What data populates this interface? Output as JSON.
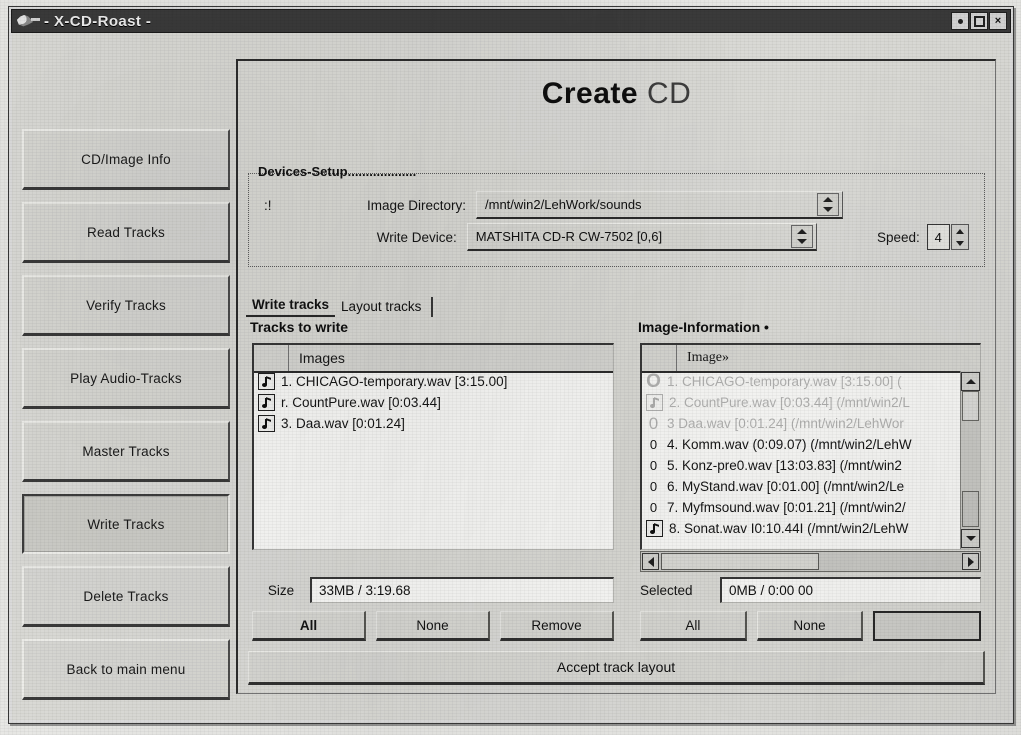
{
  "window": {
    "title": "- X-CD-Roast -",
    "icon": "app-icon",
    "buttons": [
      {
        "name": "minimize-button",
        "glyph": "dot"
      },
      {
        "name": "maximize-button",
        "glyph": "square"
      },
      {
        "name": "close-button",
        "glyph": "×"
      }
    ]
  },
  "page": {
    "title_strong": "Create",
    "title_light": "CD"
  },
  "sidebar": {
    "items": [
      {
        "label": "CD/Image Info",
        "active": false
      },
      {
        "label": "Read Tracks",
        "active": false
      },
      {
        "label": "Verify Tracks",
        "active": false
      },
      {
        "label": "Play Audio-Tracks",
        "active": false
      },
      {
        "label": "Master Tracks",
        "active": false
      },
      {
        "label": "Write Tracks",
        "active": true
      },
      {
        "label": "Delete Tracks",
        "active": false
      },
      {
        "label": "Back to main menu",
        "active": false
      }
    ]
  },
  "devices": {
    "group_label": "Devices-Setup",
    "dots": "...................",
    "marker": ":!",
    "image_dir_label": "Image Directory:",
    "image_dir_value": "/mnt/win2/LehWork/sounds",
    "write_device_label": "Write Device:",
    "write_device_value": "MATSHITA CD-R   CW-7502   [0,6]",
    "speed_label": "Speed:",
    "speed_value": "4"
  },
  "tabs": [
    {
      "label": "Write tracks",
      "active": true
    },
    {
      "label": "Layout tracks",
      "active": false
    }
  ],
  "tracks_to_write": {
    "title": "Tracks to write",
    "column_header": "Images",
    "rows": [
      {
        "icon": "music-note-icon",
        "text": "1. CHICAGO-temporary.wav [3:15.00]"
      },
      {
        "icon": "music-note-icon",
        "text": "r. CountPure.wav [0:03.44]"
      },
      {
        "icon": "music-note-icon",
        "text": "3. Daa.wav [0:01.24]"
      }
    ],
    "size_label": "Size",
    "size_value": "33MB / 3:19.68",
    "buttons": [
      {
        "label": "All",
        "name": "select-all-button",
        "bold": true
      },
      {
        "label": "None",
        "name": "select-none-button",
        "bold": false
      },
      {
        "label": "Remove",
        "name": "remove-button",
        "bold": false
      }
    ]
  },
  "image_information": {
    "title": "Image-Information",
    "title_dot": "•",
    "column_header": "Image»",
    "rows": [
      {
        "marker": "O",
        "marker_style": "bigO",
        "text": "1. CHICAGO-temporary.wav [3:15.00] (",
        "ghost": true
      },
      {
        "marker": "note",
        "marker_style": "note",
        "text": "2. CountPure.wav [0:03.44] (/mnt/win2/L",
        "ghost": true
      },
      {
        "marker": "0",
        "marker_style": "medO",
        "text": "3  Daa.wav  [0:01.24] (/mnt/win2/LehWor",
        "ghost": true
      },
      {
        "marker": "0",
        "marker_style": "plain",
        "text": "4. Komm.wav (0:09.07) (/mnt/win2/LehW",
        "ghost": false
      },
      {
        "marker": "0",
        "marker_style": "plain",
        "text": "5. Konz-pre0.wav [13:03.83] (/mnt/win2",
        "ghost": false
      },
      {
        "marker": "0",
        "marker_style": "plain",
        "text": "6. MyStand.wav [0:01.00] (/mnt/win2/Le",
        "ghost": false
      },
      {
        "marker": "0",
        "marker_style": "plain",
        "text": "7. Myfmsound.wav [0:01.21] (/mnt/win2/",
        "ghost": false
      },
      {
        "marker": "note",
        "marker_style": "note",
        "text": "8. Sonat.wav I0:10.44I (/mnt/win2/LehW",
        "ghost": false
      }
    ],
    "selected_label": "Selected",
    "selected_value": "0MB / 0:00 00",
    "buttons": [
      {
        "label": "All",
        "name": "image-select-all-button",
        "blank": false
      },
      {
        "label": "None",
        "name": "image-select-none-button",
        "blank": false
      },
      {
        "label": "",
        "name": "image-add-button",
        "blank": true
      }
    ]
  },
  "footer": {
    "accept_label": "Accept track layout"
  }
}
